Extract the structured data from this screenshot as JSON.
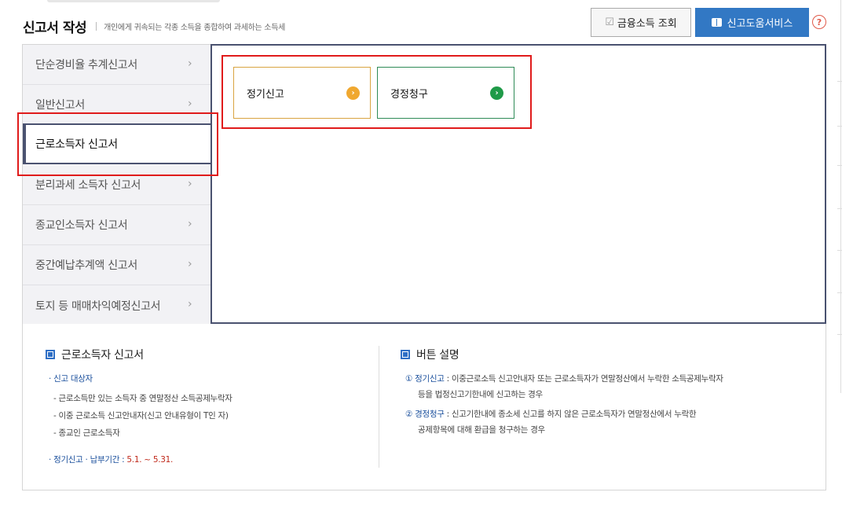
{
  "header": {
    "title": "신고서 작성",
    "subtitle": "개인에게 귀속되는 각종 소득을 종합하여 과세하는 소득세"
  },
  "toolbar": {
    "finance_label": "금융소득 조회",
    "help_label": "신고도움서비스",
    "help_icon_glyph": "?"
  },
  "sidebar": {
    "items": [
      {
        "label": "단순경비율 추계신고서"
      },
      {
        "label": "일반신고서"
      },
      {
        "label": "근로소득자 신고서",
        "active": true
      },
      {
        "label": "분리과세 소득자 신고서"
      },
      {
        "label": "종교인소득자 신고서"
      },
      {
        "label": "중간예납추계액 신고서"
      },
      {
        "label": "토지 등 매매차익예정신고서"
      }
    ]
  },
  "options": {
    "regular": {
      "label": "정기신고",
      "color": "#f0a830"
    },
    "correction": {
      "label": "경정청구",
      "color": "#1f9a48"
    }
  },
  "info": {
    "left": {
      "title": "근로소득자 신고서",
      "target_label": "신고 대상자",
      "targets": [
        "- 근로소득만 있는 소득자 중 연말정산 소득공제누락자",
        "- 이중 근로소득 신고안내자(신고 안내유형이 T인 자)",
        "- 종교인 근로소득자"
      ],
      "period_label": "정기신고 · 납부기간 :",
      "period_value": "5.1. ~ 5.31."
    },
    "right": {
      "title": "버튼 설명",
      "item1_label": "① 정기신고",
      "item1_line1": " : 이중근로소득 신고안내자 또는 근로소득자가 연말정산에서 누락한 소득공제누락자",
      "item1_line2": "등을 법정신고기한내에 신고하는 경우",
      "item2_label": "② 경정청구",
      "item2_line1": " : 신고기한내에 종소세 신고를 하지 않은 근로소득자가 연말정산에서 누락한",
      "item2_line2": "공제항목에 대해 환급을 청구하는 경우"
    }
  },
  "colors": {
    "accent": "#3278c4",
    "highlight": "#e01b1b",
    "nav_border": "#4a5270"
  }
}
